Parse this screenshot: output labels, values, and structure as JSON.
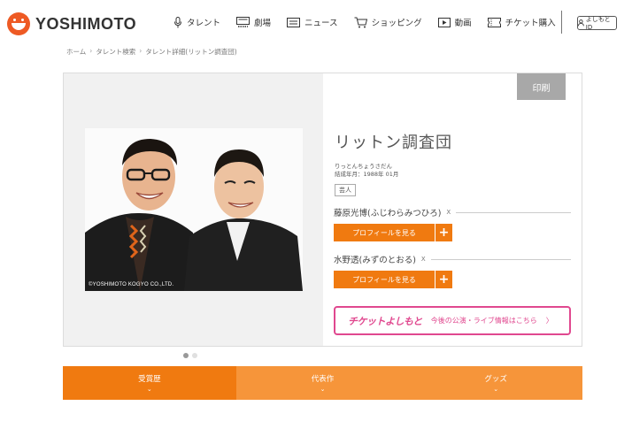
{
  "header": {
    "logo_text": "YOSHIMOTO",
    "nav": [
      {
        "label": "タレント",
        "icon": "microphone-icon"
      },
      {
        "label": "劇場",
        "icon": "theater-icon"
      },
      {
        "label": "ニュース",
        "icon": "news-icon"
      },
      {
        "label": "ショッピング",
        "icon": "cart-icon"
      },
      {
        "label": "動画",
        "icon": "video-icon"
      },
      {
        "label": "チケット購入",
        "icon": "ticket-icon"
      }
    ],
    "login_label": "よしもとID"
  },
  "breadcrumb": [
    "ホーム",
    "タレント検索",
    "タレント詳細(リットン調査団)"
  ],
  "breadcrumb_sep": "›",
  "photo": {
    "copyright": "©YOSHIMOTO KOGYO CO.,LTD."
  },
  "info": {
    "print_label": "印刷",
    "name": "リットン調査団",
    "reading": "りっとんちょうさだん",
    "formed": "結成年月：1988年 01月",
    "genre": "芸人",
    "members": [
      {
        "name": "藤原光博(ふじわらみつひろ)",
        "x_label": "X"
      },
      {
        "name": "水野透(みずのとおる)",
        "x_label": "X"
      }
    ],
    "profile_label": "プロフィールを見る",
    "profile_plus": "+"
  },
  "ticket": {
    "logo": "チケットよしもと",
    "text": "今後の公演・ライブ情報はこちら",
    "chevron": "〉"
  },
  "carousel": {
    "count": 2,
    "active": 0,
    "active_color": "#999999",
    "inactive_color": "#e0e0e0"
  },
  "tabs": [
    {
      "label": "受賞歴",
      "chevron": "⌄"
    },
    {
      "label": "代表作",
      "chevron": "⌄"
    },
    {
      "label": "グッズ",
      "chevron": "⌄"
    }
  ],
  "colors": {
    "accent": "#f07a10",
    "ticket_pink": "#e0488f",
    "logo_red": "#ee5a24"
  }
}
